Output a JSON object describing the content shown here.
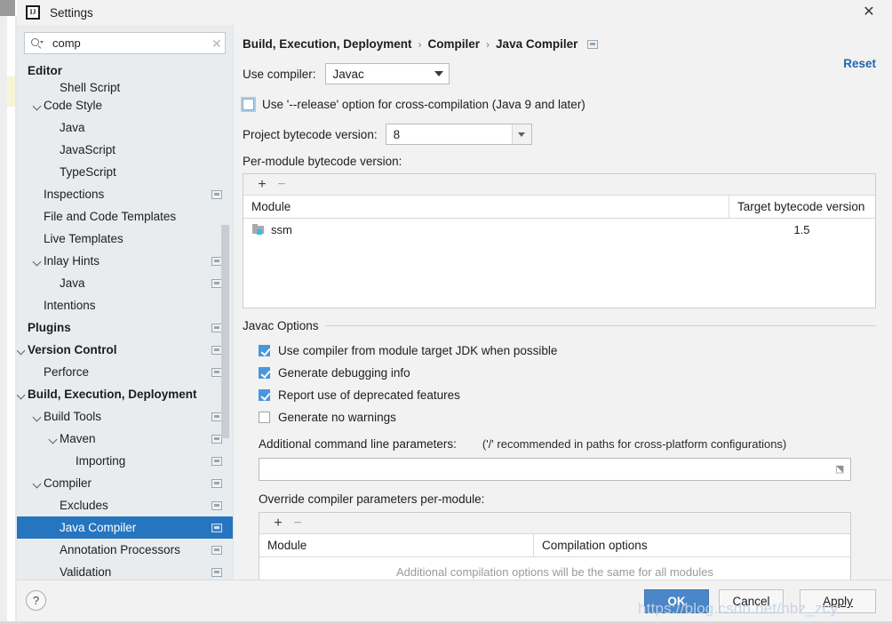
{
  "window": {
    "title": "Settings",
    "logo_icon": "intellij-idea-logo",
    "close_icon": "close-icon"
  },
  "sidebar": {
    "search": {
      "value": "comp",
      "placeholder": "",
      "search_icon": "search-icon",
      "clear_icon": "clear-icon"
    },
    "items": [
      {
        "label": "Editor",
        "indent": 0,
        "bold": true,
        "arrow": false,
        "badge": false,
        "selected": false,
        "clipped": false
      },
      {
        "label": "Shell Script",
        "indent": 2,
        "bold": false,
        "arrow": false,
        "badge": false,
        "selected": false,
        "clipped": true
      },
      {
        "label": "Code Style",
        "indent": 1,
        "bold": false,
        "arrow": true,
        "badge": false,
        "selected": false,
        "clipped": false
      },
      {
        "label": "Java",
        "indent": 2,
        "bold": false,
        "arrow": false,
        "badge": false,
        "selected": false,
        "clipped": false
      },
      {
        "label": "JavaScript",
        "indent": 2,
        "bold": false,
        "arrow": false,
        "badge": false,
        "selected": false,
        "clipped": false
      },
      {
        "label": "TypeScript",
        "indent": 2,
        "bold": false,
        "arrow": false,
        "badge": false,
        "selected": false,
        "clipped": false
      },
      {
        "label": "Inspections",
        "indent": 1,
        "bold": false,
        "arrow": false,
        "badge": true,
        "selected": false,
        "clipped": false
      },
      {
        "label": "File and Code Templates",
        "indent": 1,
        "bold": false,
        "arrow": false,
        "badge": false,
        "selected": false,
        "clipped": false
      },
      {
        "label": "Live Templates",
        "indent": 1,
        "bold": false,
        "arrow": false,
        "badge": false,
        "selected": false,
        "clipped": false
      },
      {
        "label": "Inlay Hints",
        "indent": 1,
        "bold": false,
        "arrow": true,
        "badge": true,
        "selected": false,
        "clipped": false
      },
      {
        "label": "Java",
        "indent": 2,
        "bold": false,
        "arrow": false,
        "badge": true,
        "selected": false,
        "clipped": false
      },
      {
        "label": "Intentions",
        "indent": 1,
        "bold": false,
        "arrow": false,
        "badge": false,
        "selected": false,
        "clipped": false
      },
      {
        "label": "Plugins",
        "indent": 0,
        "bold": true,
        "arrow": false,
        "badge": true,
        "selected": false,
        "clipped": false
      },
      {
        "label": "Version Control",
        "indent": 0,
        "bold": true,
        "arrow": true,
        "badge": true,
        "selected": false,
        "clipped": false
      },
      {
        "label": "Perforce",
        "indent": 1,
        "bold": false,
        "arrow": false,
        "badge": true,
        "selected": false,
        "clipped": false
      },
      {
        "label": "Build, Execution, Deployment",
        "indent": 0,
        "bold": true,
        "arrow": true,
        "badge": false,
        "selected": false,
        "clipped": false
      },
      {
        "label": "Build Tools",
        "indent": 1,
        "bold": false,
        "arrow": true,
        "badge": true,
        "selected": false,
        "clipped": false
      },
      {
        "label": "Maven",
        "indent": 2,
        "bold": false,
        "arrow": true,
        "badge": true,
        "selected": false,
        "clipped": false
      },
      {
        "label": "Importing",
        "indent": 3,
        "bold": false,
        "arrow": false,
        "badge": true,
        "selected": false,
        "clipped": false
      },
      {
        "label": "Compiler",
        "indent": 1,
        "bold": false,
        "arrow": true,
        "badge": true,
        "selected": false,
        "clipped": false
      },
      {
        "label": "Excludes",
        "indent": 2,
        "bold": false,
        "arrow": false,
        "badge": true,
        "selected": false,
        "clipped": false
      },
      {
        "label": "Java Compiler",
        "indent": 2,
        "bold": false,
        "arrow": false,
        "badge": true,
        "selected": true,
        "clipped": false
      },
      {
        "label": "Annotation Processors",
        "indent": 2,
        "bold": false,
        "arrow": false,
        "badge": true,
        "selected": false,
        "clipped": false
      },
      {
        "label": "Validation",
        "indent": 2,
        "bold": false,
        "arrow": false,
        "badge": true,
        "selected": false,
        "clipped": false
      }
    ]
  },
  "main": {
    "breadcrumb": [
      "Build, Execution, Deployment",
      "Compiler",
      "Java Compiler"
    ],
    "breadcrumb_separator": "›",
    "breadcrumb_badge_icon": "settings-badge-icon",
    "reset_label": "Reset",
    "use_compiler_label": "Use compiler:",
    "use_compiler_value": "Javac",
    "release_option_label": "Use '--release' option for cross-compilation (Java 9 and later)",
    "release_option_checked": false,
    "project_bytecode_label": "Project bytecode version:",
    "project_bytecode_value": "8",
    "per_module_label": "Per-module bytecode version:",
    "module_table": {
      "add_icon": "plus-icon",
      "remove_icon": "minus-icon",
      "columns": [
        "Module",
        "Target bytecode version"
      ],
      "rows": [
        {
          "module": "ssm",
          "module_icon": "module-folder-icon",
          "target": "1.5"
        }
      ]
    },
    "javac_section_title": "Javac Options",
    "javac_options": [
      {
        "label": "Use compiler from module target JDK when possible",
        "checked": true
      },
      {
        "label": "Generate debugging info",
        "checked": true
      },
      {
        "label": "Report use of deprecated features",
        "checked": true
      },
      {
        "label": "Generate no warnings",
        "checked": false
      }
    ],
    "additional_params_label": "Additional command line parameters:",
    "additional_params_hint": "('/' recommended in paths for cross-platform configurations)",
    "additional_params_value": "",
    "additional_params_expand_icon": "expand-editor-icon",
    "override_label": "Override compiler parameters per-module:",
    "override_table": {
      "add_icon": "plus-icon",
      "remove_icon": "minus-icon",
      "columns": [
        "Module",
        "Compilation options"
      ],
      "empty_message": "Additional compilation options will be the same for all modules"
    }
  },
  "footer": {
    "help_label": "?",
    "ok_label": "OK",
    "cancel_label": "Cancel",
    "apply_label": "Apply"
  },
  "watermark": "https://blog.csdn.net/hbz_zcy",
  "colors": {
    "accent_blue": "#2675bf",
    "checkbox_blue": "#4a96dd",
    "primary_button": "#4a86c8",
    "link_blue": "#1d66b0",
    "sidebar_bg": "#e8ecef",
    "panel_bg": "#f2f2f2"
  }
}
